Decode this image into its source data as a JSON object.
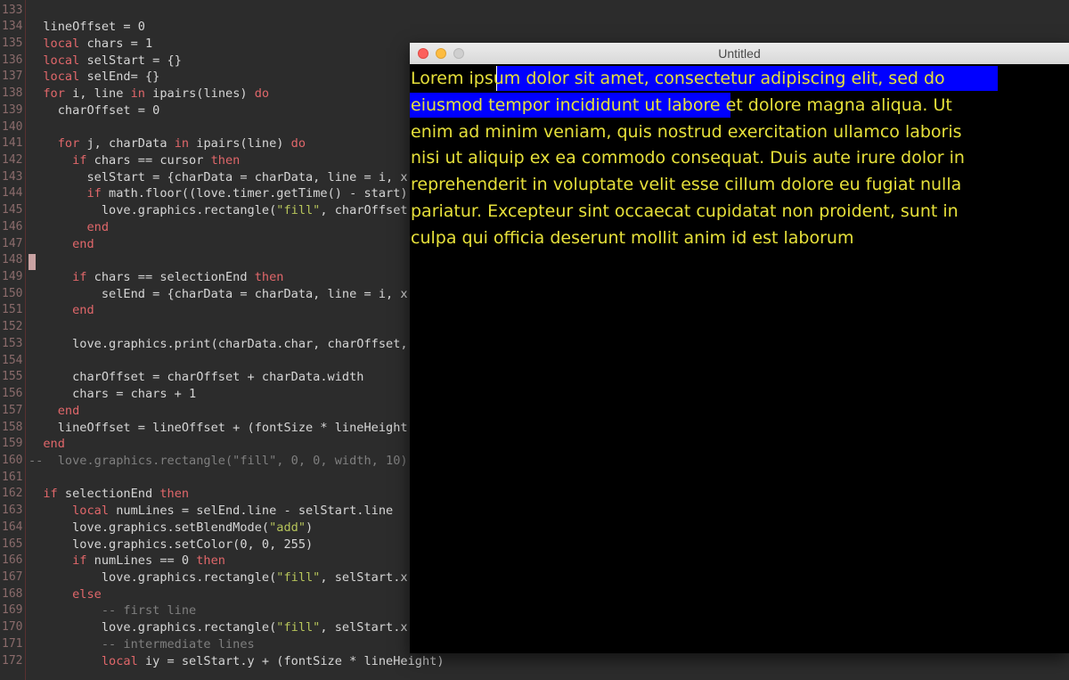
{
  "editor": {
    "lines": [
      {
        "n": "133",
        "html": ""
      },
      {
        "n": "134",
        "html": "  lineOffset = 0"
      },
      {
        "n": "135",
        "html": "  <span class=\"kw\">local</span> chars = 1"
      },
      {
        "n": "136",
        "html": "  <span class=\"kw\">local</span> selStart = {}"
      },
      {
        "n": "137",
        "html": "  <span class=\"kw\">local</span> selEnd= {}"
      },
      {
        "n": "138",
        "html": "  <span class=\"kw\">for</span> i, line <span class=\"kw\">in</span> ipairs(lines) <span class=\"kw\">do</span>"
      },
      {
        "n": "139",
        "html": "    charOffset = 0"
      },
      {
        "n": "140",
        "html": ""
      },
      {
        "n": "141",
        "html": "    <span class=\"kw\">for</span> j, charData <span class=\"kw\">in</span> ipairs(line) <span class=\"kw\">do</span>"
      },
      {
        "n": "142",
        "html": "      <span class=\"kw\">if</span> chars == cursor <span class=\"kw\">then</span>"
      },
      {
        "n": "143",
        "html": "        selStart = {charData = charData, line = i, x = "
      },
      {
        "n": "144",
        "html": "        <span class=\"kw\">if</span> math.floor((love.timer.getTime() - start) * "
      },
      {
        "n": "145",
        "html": "          love.graphics.rectangle(<span class=\"str\">\"fill\"</span>, charOffset, li"
      },
      {
        "n": "146",
        "html": "        <span class=\"kw\">end</span>"
      },
      {
        "n": "147",
        "html": "      <span class=\"kw\">end</span>"
      },
      {
        "n": "148",
        "html": ""
      },
      {
        "n": "149",
        "html": "      <span class=\"kw\">if</span> chars == selectionEnd <span class=\"kw\">then</span>"
      },
      {
        "n": "150",
        "html": "          selEnd = {charData = charData, line = i, x = c"
      },
      {
        "n": "151",
        "html": "      <span class=\"kw\">end</span>"
      },
      {
        "n": "152",
        "html": ""
      },
      {
        "n": "153",
        "html": "      love.graphics.print(charData.char, charOffset, lin"
      },
      {
        "n": "154",
        "html": ""
      },
      {
        "n": "155",
        "html": "      charOffset = charOffset + charData.width"
      },
      {
        "n": "156",
        "html": "      chars = chars + 1"
      },
      {
        "n": "157",
        "html": "    <span class=\"kw\">end</span>"
      },
      {
        "n": "158",
        "html": "    lineOffset = lineOffset + (fontSize * lineHeight)"
      },
      {
        "n": "159",
        "html": "  <span class=\"kw\">end</span>"
      },
      {
        "n": "160",
        "html": "<span class=\"cm\">--  love.graphics.rectangle(\"fill\", 0, 0, width, 10)</span>"
      },
      {
        "n": "161",
        "html": ""
      },
      {
        "n": "162",
        "html": "  <span class=\"kw\">if</span> selectionEnd <span class=\"kw\">then</span>"
      },
      {
        "n": "163",
        "html": "      <span class=\"kw\">local</span> numLines = selEnd.line - selStart.line"
      },
      {
        "n": "164",
        "html": "      love.graphics.setBlendMode(<span class=\"str\">\"add\"</span>)"
      },
      {
        "n": "165",
        "html": "      love.graphics.setColor(0, 0, 255)"
      },
      {
        "n": "166",
        "html": "      <span class=\"kw\">if</span> numLines == 0 <span class=\"kw\">then</span>"
      },
      {
        "n": "167",
        "html": "          love.graphics.rectangle(<span class=\"str\">\"fill\"</span>, selStart.x, se"
      },
      {
        "n": "168",
        "html": "      <span class=\"kw\">else</span>"
      },
      {
        "n": "169",
        "html": "          <span class=\"cm\">-- first line</span>"
      },
      {
        "n": "170",
        "html": "          love.graphics.rectangle(<span class=\"str\">\"fill\"</span>, selStart.x, se"
      },
      {
        "n": "171",
        "html": "          <span class=\"cm\">-- intermediate lines</span>"
      },
      {
        "n": "172",
        "html": "          <span class=\"kw\">local</span> iy = selStart.y + (fontSize * lineHeight)"
      }
    ]
  },
  "window": {
    "title": "Untitled",
    "text_lines": [
      "Lorem ipsum dolor sit amet, consectetur adipiscing elit, sed do",
      "eiusmod tempor incididunt ut labore et dolore magna aliqua. Ut",
      "enim ad minim veniam, quis nostrud exercitation ullamco laboris",
      "nisi ut aliquip ex ea commodo consequat. Duis aute irure dolor in",
      "reprehenderit in voluptate velit esse cillum dolore eu fugiat nulla",
      "pariatur. Excepteur sint occaecat cupidatat non proident, sunt in",
      "culpa qui officia deserunt mollit anim id est laborum"
    ]
  },
  "colors": {
    "text": "#e6e03a",
    "selection": "#0000ff",
    "keyword": "#e0676a",
    "string": "#b6c45a"
  }
}
